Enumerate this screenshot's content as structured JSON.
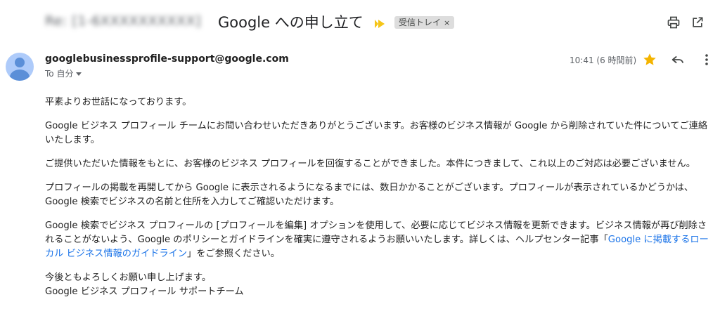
{
  "header": {
    "subject_prefix_redacted": "Re: [1-6XXXXXXXXXX]",
    "subject": "Google への申し立て",
    "label_chip": "受信トレイ",
    "label_remove": "×"
  },
  "message": {
    "sender_email": "googlebusinessprofile-support@google.com",
    "to_line": "To 自分",
    "timestamp": "10:41 (6 時間前)",
    "starred": true
  },
  "body": {
    "p1": "平素よりお世話になっております。",
    "p2": "Google ビジネス プロフィール チームにお問い合わせいただきありがとうございます。お客様のビジネス情報が Google から削除されていた件についてご連絡いたします。",
    "p3": "ご提供いただいた情報をもとに、お客様のビジネス プロフィールを回復することができました。本件につきまして、これ以上のご対応は必要ございません。",
    "p4": "プロフィールの掲載を再開してから Google に表示されるようになるまでには、数日かかることがございます。プロフィールが表示されているかどうかは、Google 検索でビジネスの名前と住所を入力してご確認いただけます。",
    "p5_before_link": "Google 検索でビジネス プロフィールの [プロフィールを編集] オプションを使用して、必要に応じてビジネス情報を更新できます。ビジネス情報が再び削除されることがないよう、Google のポリシーとガイドラインを確実に遵守されるようお願いいたします。詳しくは、ヘルプセンター記事「",
    "p5_link": "Google に掲載するローカル ビジネス情報のガイドライン",
    "p5_after_link": "」をご参照ください。",
    "closing_line1": "今後ともよろしくお願い申し上げます。",
    "closing_line2": "Google ビジネス プロフィール サポートチーム"
  },
  "colors": {
    "link": "#1a73e8",
    "star": "#f4b400",
    "important_marker": "#f5c518"
  }
}
